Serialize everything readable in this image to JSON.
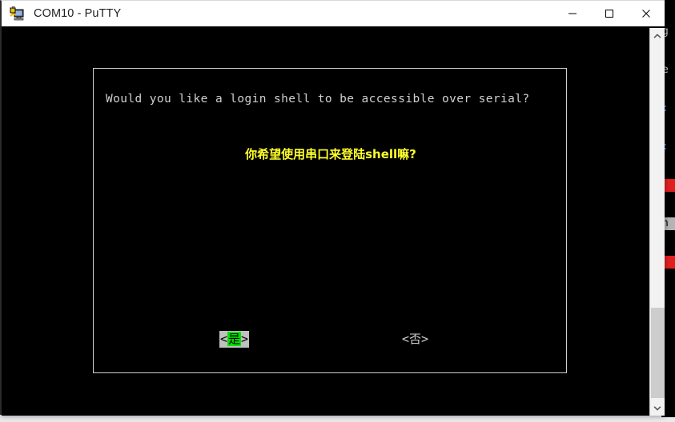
{
  "window": {
    "title": "COM10 - PuTTY",
    "icon": "putty-computer-plug-icon",
    "controls": {
      "minimize_label": "─",
      "maximize_label": "□",
      "close_label": "✕"
    }
  },
  "terminal": {
    "background_color": "#000000",
    "foreground_color": "#d0d0d0"
  },
  "dialog": {
    "question_en": "Would you like a login shell to be accessible over serial?",
    "question_cn": "你希望使用串口来登陆shell嘛?",
    "question_cn_color": "#ffff2a",
    "buttons": [
      {
        "name": "yes",
        "bracket_left": "<",
        "label": "是",
        "bracket_right": ">",
        "selected": true,
        "highlight_color": "#00e000",
        "frame_color": "#c0c0c0"
      },
      {
        "name": "no",
        "bracket_left": "<",
        "label": "否",
        "bracket_right": ">",
        "selected": false,
        "text_color": "#d0d0d0"
      }
    ]
  },
  "scrollbar": {
    "up_arrow": "⌃",
    "down_arrow": "⌄",
    "thumb_color": "#cdcdcd",
    "track_color": "#f2f2f2"
  },
  "background_window": {
    "lines": [
      {
        "text": "g",
        "style": "plain"
      },
      {
        "text": "e",
        "style": "plain"
      },
      {
        "text": ":",
        "style": "blue"
      },
      {
        "text": ":",
        "style": "blue"
      },
      {
        "text": " ",
        "style": "red"
      },
      {
        "text": "n",
        "style": "selected"
      },
      {
        "text": " ",
        "style": "red"
      }
    ]
  }
}
